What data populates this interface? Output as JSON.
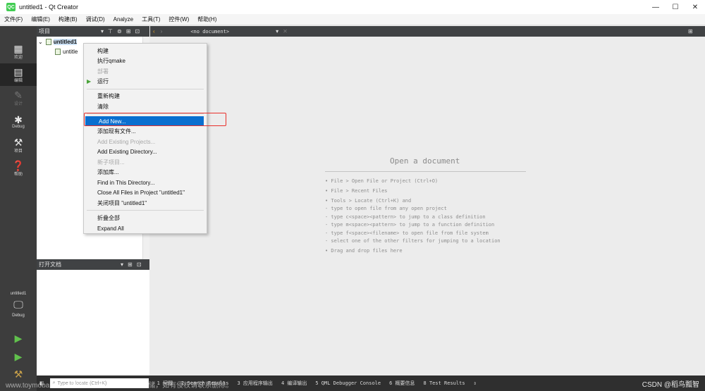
{
  "window": {
    "title": "untitled1 - Qt Creator",
    "app_icon": "QC",
    "controls": [
      "—",
      "☐",
      "✕"
    ]
  },
  "menubar": [
    "文件(F)",
    "编辑(E)",
    "构建(B)",
    "调试(D)",
    "Analyze",
    "工具(T)",
    "控件(W)",
    "帮助(H)"
  ],
  "modes": [
    {
      "label": "欢迎",
      "icon": "grid-icon"
    },
    {
      "label": "编辑",
      "icon": "edit-icon"
    },
    {
      "label": "设计",
      "icon": "pencil-icon"
    },
    {
      "label": "Debug",
      "icon": "bug-icon"
    },
    {
      "label": "项目",
      "icon": "wrench-icon"
    },
    {
      "label": "帮助",
      "icon": "help-icon"
    }
  ],
  "kit": {
    "project": "untitled1",
    "build": "Debug"
  },
  "project_panel": {
    "title": "项目",
    "root": "untitled1",
    "child": "untitle"
  },
  "editor_toolbar": {
    "document": "<no document>"
  },
  "open_docs": {
    "title": "打开文档"
  },
  "context_menu": [
    {
      "label": "构建",
      "enabled": true
    },
    {
      "label": "执行qmake",
      "enabled": true
    },
    {
      "label": "部署",
      "enabled": false
    },
    {
      "label": "运行",
      "enabled": true
    },
    {
      "label": "重新构建",
      "enabled": true
    },
    {
      "label": "清除",
      "enabled": true
    },
    {
      "label": "Add New...",
      "enabled": true
    },
    {
      "label": "添加现有文件...",
      "enabled": true
    },
    {
      "label": "Add Existing Projects...",
      "enabled": false
    },
    {
      "label": "Add Existing Directory...",
      "enabled": true
    },
    {
      "label": "新子项目...",
      "enabled": false
    },
    {
      "label": "添加库...",
      "enabled": true
    },
    {
      "label": "Find in This Directory...",
      "enabled": true
    },
    {
      "label": "Close All Files in Project \"untitled1\"",
      "enabled": true
    },
    {
      "label": "关闭项目 \"untitled1\"",
      "enabled": true
    },
    {
      "label": "折叠全部",
      "enabled": true
    },
    {
      "label": "Expand All",
      "enabled": true
    }
  ],
  "welcome": {
    "title": "Open a document",
    "hints": [
      "• File > Open File or Project (Ctrl+O)",
      "• File > Recent Files",
      "• Tools > Locate (Ctrl+K) and",
      "  - type to open file from any open project",
      "  - type c<space><pattern> to jump to a class definition",
      "  - type m<space><pattern> to jump to a function definition",
      "  - type f<space><filename> to open file from file system",
      "  - select one of the other filters for jumping to a location",
      "• Drag and drop files here"
    ]
  },
  "statusbar": {
    "locator_placeholder": "Type to locate (Ctrl+K)",
    "panes": [
      "1 问题",
      "2 Search Results",
      "3 应用程序输出",
      "4 编译输出",
      "5 QML Debugger Console",
      "6 概要信息",
      "8 Test Results"
    ]
  },
  "watermark": {
    "csdn": "CSDN @稻鸟瓢智",
    "site": "www.toymoban.com 网络图片仅供展示，非存储，如有侵权请联系删除。"
  }
}
